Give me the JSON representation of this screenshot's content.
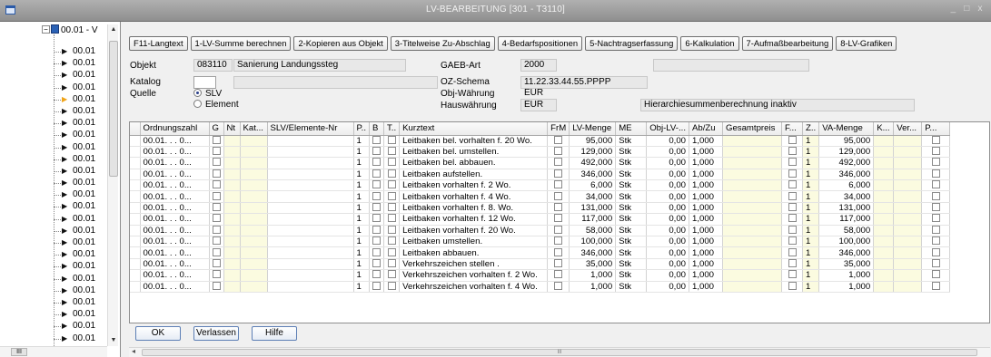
{
  "window": {
    "title": "LV-BEARBEITUNG  [301 - T3110]",
    "minimize": "_",
    "maximize": "□",
    "close": "x"
  },
  "tree": {
    "root_label": "00.01 - V",
    "root_expander": "−",
    "items": [
      "00.01",
      "00.01",
      "00.01",
      "00.01",
      "00.01",
      "00.01",
      "00.01",
      "00.01",
      "00.01",
      "00.01",
      "00.01",
      "00.01",
      "00.01",
      "00.01",
      "00.01",
      "00.01",
      "00.01",
      "00.01",
      "00.01",
      "00.01",
      "00.01",
      "00.01",
      "00.01",
      "00.01",
      "00.01",
      "00.01"
    ],
    "marker_current": "▶",
    "hscroll_thumb": "III",
    "scroll_up": "▲",
    "scroll_down": "▼"
  },
  "toolbar": {
    "buttons": [
      "F11-Langtext",
      "1-LV-Summe berechnen",
      "2-Kopieren aus Objekt",
      "3-Titelweise Zu-Abschlag",
      "4-Bedarfspositionen",
      "5-Nachtragserfassung",
      "6-Kalkulation",
      "7-Aufmaßbearbeitung",
      "8-LV-Grafiken"
    ]
  },
  "form": {
    "objekt_label": "Objekt",
    "objekt_value": "083110",
    "objekt_name": "Sanierung Landungssteg",
    "gaeb_label": "GAEB-Art",
    "gaeb_value": "2000",
    "katalog_label": "Katalog",
    "katalog_value": "",
    "quelle_label": "Quelle",
    "quelle_slv": "SLV",
    "quelle_element": "Element",
    "oz_label": "OZ-Schema",
    "oz_value": "11.22.33.44.55.PPPP",
    "objwaehrung_label": "Obj-Währung",
    "objwaehrung_value": "EUR",
    "hauswaehrung_label": "Hauswährung",
    "hauswaehrung_value": "EUR",
    "hierarchie_text": "Hierarchiesummenberechnung inaktiv"
  },
  "grid": {
    "columns": [
      "",
      "Ordnungszahl",
      "G",
      "Nt",
      "Kat...",
      "SLV/Elemente-Nr",
      "P..",
      "B",
      "T..",
      "Kurztext",
      "FrM",
      "LV-Menge",
      "ME",
      "Obj-LV-...",
      "Ab/Zu",
      "Gesamtpreis",
      "F...",
      "Z..",
      "VA-Menge",
      "K...",
      "Ver...",
      "P..."
    ],
    "rows": [
      {
        "oz": "00.01. . . 0...",
        "p": "1",
        "kurztext": "Leitbaken bel. vorhalten f. 20 Wo.",
        "lv_menge": "95,000",
        "me": "Stk",
        "obj": "0,00",
        "abzu": "1,000",
        "z": "1",
        "va_menge": "95,000"
      },
      {
        "oz": "00.01. . . 0...",
        "p": "1",
        "kurztext": "Leitbaken bel. umstellen.",
        "lv_menge": "129,000",
        "me": "Stk",
        "obj": "0,00",
        "abzu": "1,000",
        "z": "1",
        "va_menge": "129,000"
      },
      {
        "oz": "00.01. . . 0...",
        "p": "1",
        "kurztext": "Leitbaken bel. abbauen.",
        "lv_menge": "492,000",
        "me": "Stk",
        "obj": "0,00",
        "abzu": "1,000",
        "z": "1",
        "va_menge": "492,000"
      },
      {
        "oz": "00.01. . . 0...",
        "p": "1",
        "kurztext": "Leitbaken aufstellen.",
        "lv_menge": "346,000",
        "me": "Stk",
        "obj": "0,00",
        "abzu": "1,000",
        "z": "1",
        "va_menge": "346,000"
      },
      {
        "oz": "00.01. . . 0...",
        "p": "1",
        "kurztext": "Leitbaken vorhalten f. 2 Wo.",
        "lv_menge": "6,000",
        "me": "Stk",
        "obj": "0,00",
        "abzu": "1,000",
        "z": "1",
        "va_menge": "6,000"
      },
      {
        "oz": "00.01. . . 0...",
        "p": "1",
        "kurztext": "Leitbaken vorhalten f. 4 Wo.",
        "lv_menge": "34,000",
        "me": "Stk",
        "obj": "0,00",
        "abzu": "1,000",
        "z": "1",
        "va_menge": "34,000"
      },
      {
        "oz": "00.01. . . 0...",
        "p": "1",
        "kurztext": "Leitbaken vorhalten f. 8. Wo.",
        "lv_menge": "131,000",
        "me": "Stk",
        "obj": "0,00",
        "abzu": "1,000",
        "z": "1",
        "va_menge": "131,000"
      },
      {
        "oz": "00.01. . . 0...",
        "p": "1",
        "kurztext": "Leitbaken vorhalten f. 12 Wo.",
        "lv_menge": "117,000",
        "me": "Stk",
        "obj": "0,00",
        "abzu": "1,000",
        "z": "1",
        "va_menge": "117,000"
      },
      {
        "oz": "00.01. . . 0...",
        "p": "1",
        "kurztext": "Leitbaken vorhalten f. 20 Wo.",
        "lv_menge": "58,000",
        "me": "Stk",
        "obj": "0,00",
        "abzu": "1,000",
        "z": "1",
        "va_menge": "58,000"
      },
      {
        "oz": "00.01. . . 0...",
        "p": "1",
        "kurztext": "Leitbaken umstellen.",
        "lv_menge": "100,000",
        "me": "Stk",
        "obj": "0,00",
        "abzu": "1,000",
        "z": "1",
        "va_menge": "100,000"
      },
      {
        "oz": "00.01. . . 0...",
        "p": "1",
        "kurztext": "Leitbaken abbauen.",
        "lv_menge": "346,000",
        "me": "Stk",
        "obj": "0,00",
        "abzu": "1,000",
        "z": "1",
        "va_menge": "346,000"
      },
      {
        "oz": "00.01. . . 0...",
        "p": "1",
        "kurztext": "Verkehrszeichen stellen .",
        "lv_menge": "35,000",
        "me": "Stk",
        "obj": "0,00",
        "abzu": "1,000",
        "z": "1",
        "va_menge": "35,000"
      },
      {
        "oz": "00.01. . . 0...",
        "p": "1",
        "kurztext": "Verkehrszeichen vorhalten f. 2 Wo.",
        "lv_menge": "1,000",
        "me": "Stk",
        "obj": "0,00",
        "abzu": "1,000",
        "z": "1",
        "va_menge": "1,000"
      },
      {
        "oz": "00.01. . . 0...",
        "p": "1",
        "kurztext": "Verkehrszeichen vorhalten f. 4 Wo.",
        "lv_menge": "1,000",
        "me": "Stk",
        "obj": "0,00",
        "abzu": "1,000",
        "z": "1",
        "va_menge": "1,000"
      }
    ],
    "hscroll_thumb": "III"
  },
  "buttons": {
    "ok": "OK",
    "verlassen": "Verlassen",
    "hilfe": "Hilfe"
  },
  "colors": {
    "titlebar": "#9a9a9a",
    "yellow_cell": "#fbfbe0",
    "button_border": "#5d7fb5"
  }
}
